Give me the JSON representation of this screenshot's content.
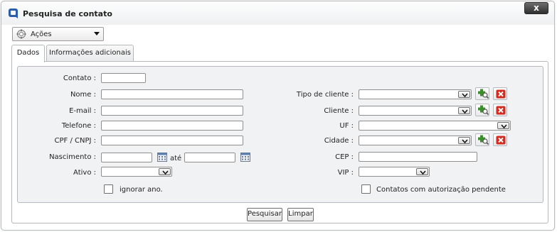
{
  "dialog": {
    "title": "Pesquisa de contato",
    "close_label": "x"
  },
  "actions_menu": {
    "label": "Ações"
  },
  "tabs": [
    {
      "label": "Dados",
      "active": true
    },
    {
      "label": "Informações adicionais",
      "active": false
    }
  ],
  "form": {
    "contato": {
      "label": "Contato :",
      "value": ""
    },
    "nome": {
      "label": "Nome :",
      "value": ""
    },
    "email": {
      "label": "E-mail :",
      "value": ""
    },
    "telefone": {
      "label": "Telefone :",
      "value": ""
    },
    "cpf_cnpj": {
      "label": "CPF / CNPJ :",
      "value": ""
    },
    "nascimento": {
      "label": "Nascimento :",
      "from": "",
      "to": "",
      "between": "até"
    },
    "ativo": {
      "label": "Ativo :",
      "selected": ""
    },
    "ignorar_ano": {
      "label": "ignorar ano.",
      "checked": false
    },
    "tipo_cliente": {
      "label": "Tipo de cliente :",
      "selected": ""
    },
    "cliente": {
      "label": "Cliente :",
      "selected": ""
    },
    "uf": {
      "label": "UF :",
      "selected": ""
    },
    "cidade": {
      "label": "Cidade :",
      "selected": ""
    },
    "cep": {
      "label": "CEP :",
      "value": ""
    },
    "vip": {
      "label": "VIP :",
      "selected": ""
    },
    "contatos_autorizacao": {
      "label": "Contatos com autorização pendente",
      "checked": false
    }
  },
  "buttons": {
    "search": "Pesquisar",
    "clear": "Limpar"
  },
  "colors": {
    "add_icon": "#3a8f2a",
    "remove_icon": "#d42a20",
    "title_icon": "#2a5ea8"
  }
}
